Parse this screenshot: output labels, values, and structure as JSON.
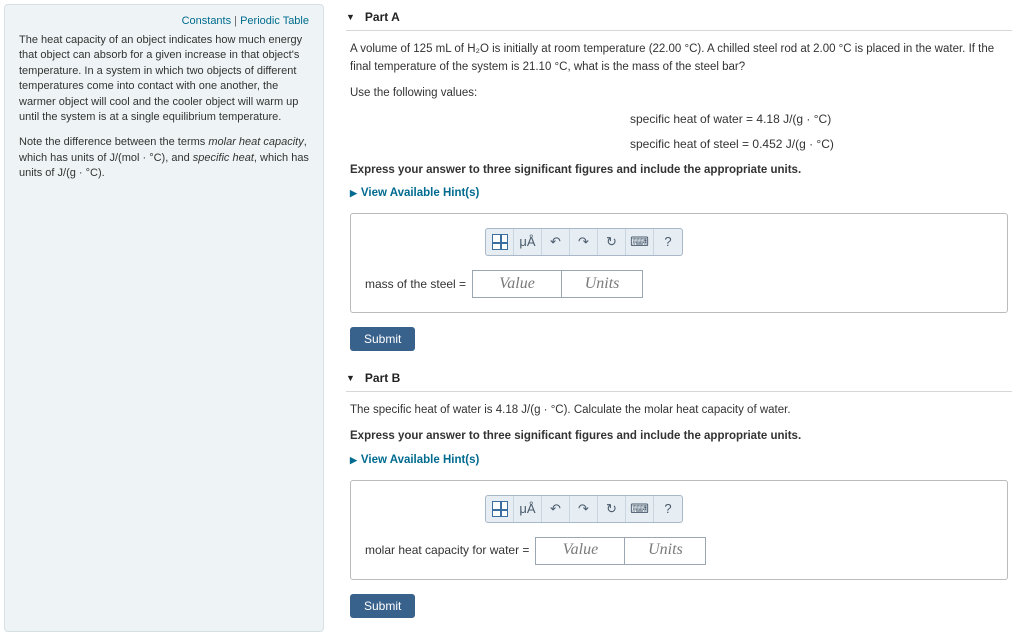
{
  "sidebar": {
    "link_constants": "Constants",
    "link_sep": " | ",
    "link_periodic": "Periodic Table",
    "para1": "The heat capacity of an object indicates how much energy that object can absorb for a given increase in that object's temperature. In a system in which two objects of different temperatures come into contact with one another, the warmer object will cool and the cooler object will warm up until the system is at a single equilibrium temperature.",
    "para2_prefix": "Note the difference between the terms ",
    "para2_m1": "molar heat capacity",
    "para2_mid": ", which has units of J/(mol · °C), and ",
    "para2_m2": "specific heat",
    "para2_suffix": ", which has units of J/(g · °C)."
  },
  "partA": {
    "title": "Part A",
    "q_line1": "A volume of 125 mL of H₂O is initially at room temperature (22.00 °C). A chilled steel rod at 2.00 °C is placed in the water. If the final temperature of the system is 21.10 °C, what is the mass of the steel bar?",
    "q_line2": "Use the following values:",
    "val1": "specific heat of water = 4.18 J/(g · °C)",
    "val2": "specific heat of steel = 0.452 J/(g · °C)",
    "bold": "Express your answer to three significant figures and include the appropriate units.",
    "hints": "View Available Hint(s)",
    "answer_label": "mass of the steel =",
    "value_ph": "Value",
    "units_ph": "Units",
    "submit": "Submit"
  },
  "partB": {
    "title": "Part B",
    "q_line1": "The specific heat of water is 4.18 J/(g · °C). Calculate the molar heat capacity of water.",
    "bold": "Express your answer to three significant figures and include the appropriate units.",
    "hints": "View Available Hint(s)",
    "answer_label": "molar heat capacity for water =",
    "value_ph": "Value",
    "units_ph": "Units",
    "submit": "Submit"
  },
  "toolbar": {
    "mu": "μÅ",
    "undo": "↶",
    "redo": "↷",
    "reset": "↻",
    "keyboard": "⌨",
    "help": "?"
  }
}
